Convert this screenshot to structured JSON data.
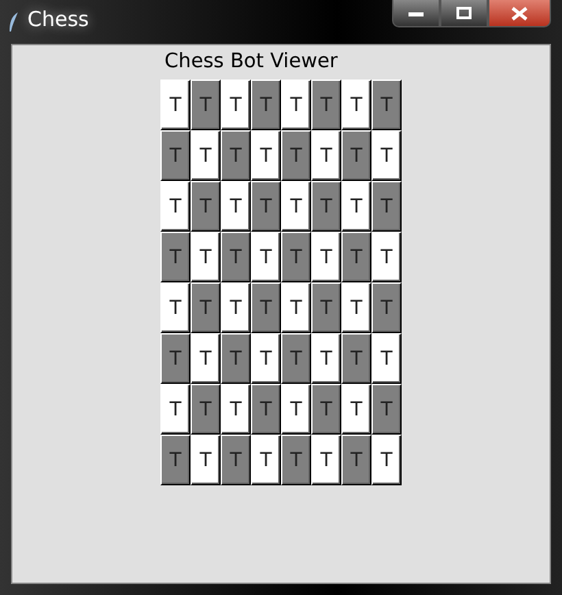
{
  "window": {
    "title": "Chess",
    "controls": [
      {
        "kind": "minimize"
      },
      {
        "kind": "maximize"
      },
      {
        "kind": "close"
      }
    ]
  },
  "heading": "Chess Bot Viewer",
  "board": {
    "rows": [
      [
        {
          "label": "T",
          "color": "#ffffff"
        },
        {
          "label": "T",
          "color": "#808080"
        },
        {
          "label": "T",
          "color": "#ffffff"
        },
        {
          "label": "T",
          "color": "#808080"
        },
        {
          "label": "T",
          "color": "#ffffff"
        },
        {
          "label": "T",
          "color": "#808080"
        },
        {
          "label": "T",
          "color": "#ffffff"
        },
        {
          "label": "T",
          "color": "#808080"
        }
      ],
      [
        {
          "label": "T",
          "color": "#808080"
        },
        {
          "label": "T",
          "color": "#ffffff"
        },
        {
          "label": "T",
          "color": "#808080"
        },
        {
          "label": "T",
          "color": "#ffffff"
        },
        {
          "label": "T",
          "color": "#808080"
        },
        {
          "label": "T",
          "color": "#ffffff"
        },
        {
          "label": "T",
          "color": "#808080"
        },
        {
          "label": "T",
          "color": "#ffffff"
        }
      ],
      [
        {
          "label": "T",
          "color": "#ffffff"
        },
        {
          "label": "T",
          "color": "#808080"
        },
        {
          "label": "T",
          "color": "#ffffff"
        },
        {
          "label": "T",
          "color": "#808080"
        },
        {
          "label": "T",
          "color": "#ffffff"
        },
        {
          "label": "T",
          "color": "#808080"
        },
        {
          "label": "T",
          "color": "#ffffff"
        },
        {
          "label": "T",
          "color": "#808080"
        }
      ],
      [
        {
          "label": "T",
          "color": "#808080"
        },
        {
          "label": "T",
          "color": "#ffffff"
        },
        {
          "label": "T",
          "color": "#808080"
        },
        {
          "label": "T",
          "color": "#ffffff"
        },
        {
          "label": "T",
          "color": "#808080"
        },
        {
          "label": "T",
          "color": "#ffffff"
        },
        {
          "label": "T",
          "color": "#808080"
        },
        {
          "label": "T",
          "color": "#ffffff"
        }
      ],
      [
        {
          "label": "T",
          "color": "#ffffff"
        },
        {
          "label": "T",
          "color": "#808080"
        },
        {
          "label": "T",
          "color": "#ffffff"
        },
        {
          "label": "T",
          "color": "#808080"
        },
        {
          "label": "T",
          "color": "#ffffff"
        },
        {
          "label": "T",
          "color": "#808080"
        },
        {
          "label": "T",
          "color": "#ffffff"
        },
        {
          "label": "T",
          "color": "#808080"
        }
      ],
      [
        {
          "label": "T",
          "color": "#808080"
        },
        {
          "label": "T",
          "color": "#ffffff"
        },
        {
          "label": "T",
          "color": "#808080"
        },
        {
          "label": "T",
          "color": "#ffffff"
        },
        {
          "label": "T",
          "color": "#808080"
        },
        {
          "label": "T",
          "color": "#ffffff"
        },
        {
          "label": "T",
          "color": "#808080"
        },
        {
          "label": "T",
          "color": "#ffffff"
        }
      ],
      [
        {
          "label": "T",
          "color": "#ffffff"
        },
        {
          "label": "T",
          "color": "#808080"
        },
        {
          "label": "T",
          "color": "#ffffff"
        },
        {
          "label": "T",
          "color": "#808080"
        },
        {
          "label": "T",
          "color": "#ffffff"
        },
        {
          "label": "T",
          "color": "#808080"
        },
        {
          "label": "T",
          "color": "#ffffff"
        },
        {
          "label": "T",
          "color": "#808080"
        }
      ],
      [
        {
          "label": "T",
          "color": "#808080"
        },
        {
          "label": "T",
          "color": "#ffffff"
        },
        {
          "label": "T",
          "color": "#808080"
        },
        {
          "label": "T",
          "color": "#ffffff"
        },
        {
          "label": "T",
          "color": "#808080"
        },
        {
          "label": "T",
          "color": "#ffffff"
        },
        {
          "label": "T",
          "color": "#808080"
        },
        {
          "label": "T",
          "color": "#ffffff"
        }
      ]
    ]
  }
}
